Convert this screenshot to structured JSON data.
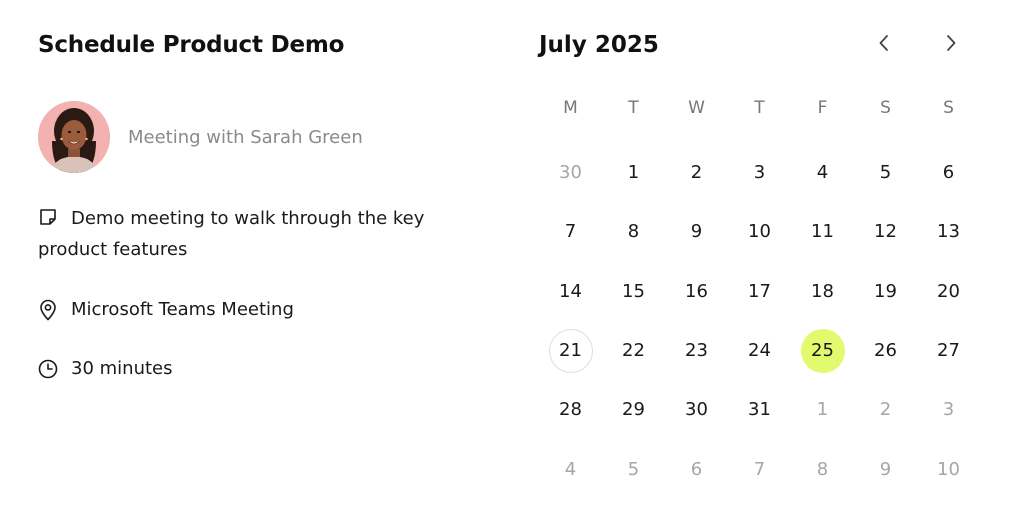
{
  "event": {
    "title": "Schedule Product Demo",
    "host": "Meeting with Sarah Green",
    "description": "Demo meeting to walk through the key product features",
    "location": "Microsoft Teams Meeting",
    "duration": "30 minutes"
  },
  "calendar": {
    "month_label": "July 2025",
    "weekdays": [
      "M",
      "T",
      "W",
      "T",
      "F",
      "S",
      "S"
    ],
    "days": [
      {
        "label": "30",
        "other": true
      },
      {
        "label": "1"
      },
      {
        "label": "2"
      },
      {
        "label": "3"
      },
      {
        "label": "4"
      },
      {
        "label": "5"
      },
      {
        "label": "6"
      },
      {
        "label": "7"
      },
      {
        "label": "8"
      },
      {
        "label": "9"
      },
      {
        "label": "10"
      },
      {
        "label": "11"
      },
      {
        "label": "12"
      },
      {
        "label": "13"
      },
      {
        "label": "14"
      },
      {
        "label": "15"
      },
      {
        "label": "16"
      },
      {
        "label": "17"
      },
      {
        "label": "18"
      },
      {
        "label": "19"
      },
      {
        "label": "20"
      },
      {
        "label": "21",
        "today": true
      },
      {
        "label": "22"
      },
      {
        "label": "23"
      },
      {
        "label": "24"
      },
      {
        "label": "25",
        "selected": true
      },
      {
        "label": "26"
      },
      {
        "label": "27"
      },
      {
        "label": "28"
      },
      {
        "label": "29"
      },
      {
        "label": "30"
      },
      {
        "label": "31"
      },
      {
        "label": "1",
        "other": true
      },
      {
        "label": "2",
        "other": true
      },
      {
        "label": "3",
        "other": true
      },
      {
        "label": "4",
        "other": true
      },
      {
        "label": "5",
        "other": true
      },
      {
        "label": "6",
        "other": true
      },
      {
        "label": "7",
        "other": true
      },
      {
        "label": "8",
        "other": true
      },
      {
        "label": "9",
        "other": true
      },
      {
        "label": "10",
        "other": true
      }
    ],
    "selected_color": "#e2fa6e"
  },
  "icons": {
    "description": "note-icon",
    "location": "map-pin-icon",
    "duration": "clock-icon",
    "prev": "chevron-left-icon",
    "next": "chevron-right-icon"
  }
}
